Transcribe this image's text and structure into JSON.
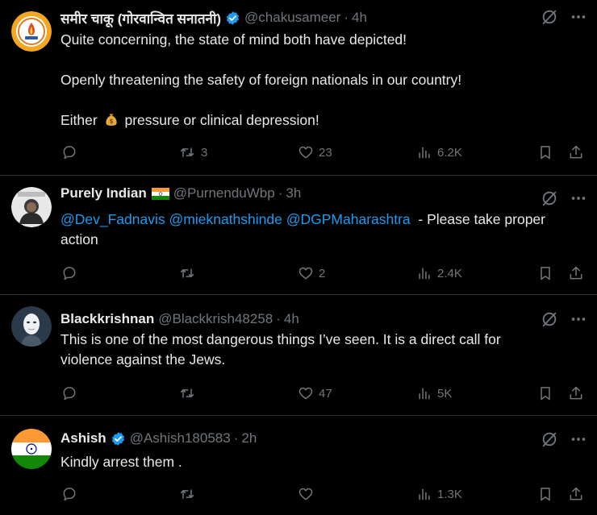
{
  "tweets": [
    {
      "name": "समीर चाकू (गोरवान्वित सनातनी)",
      "handle": "@chakusameer",
      "time": "4h",
      "verified": true,
      "lines": [
        "Quite concerning, the state of mind both have depicted!",
        "Openly threatening the safety of foreign nationals in our country!",
        "Either",
        "pressure or clinical depression!"
      ],
      "retweets": "3",
      "likes": "23",
      "views": "6.2K"
    },
    {
      "name": "Purely Indian",
      "handle": "@PurnenduWbp",
      "time": "3h",
      "verified": false,
      "mentions": [
        "@Dev_Fadnavis",
        "@mieknathshinde",
        "@DGPMaharashtra"
      ],
      "line1_rest": "- Please take proper",
      "line2": "action",
      "retweets": "",
      "likes": "2",
      "views": "2.4K"
    },
    {
      "name": "Blackkrishnan",
      "handle": "@Blackkrish48258",
      "time": "4h",
      "verified": false,
      "line1": "This is one of the most dangerous things I’ve seen. It is a direct call for",
      "line2": "violence against the Jews.",
      "retweets": "",
      "likes": "47",
      "views": "5K"
    },
    {
      "name": "Ashish",
      "handle": "@Ashish180583",
      "time": "2h",
      "verified": true,
      "line1": "Kindly arrest them .",
      "retweets": "",
      "likes": "",
      "views": "1.3K"
    }
  ],
  "colors": {
    "background": "#000000",
    "text": "#e7e9ea",
    "muted": "#71767b",
    "link": "#1d9bf0",
    "divider": "#2f3336",
    "verified": "#1d9bf0"
  }
}
